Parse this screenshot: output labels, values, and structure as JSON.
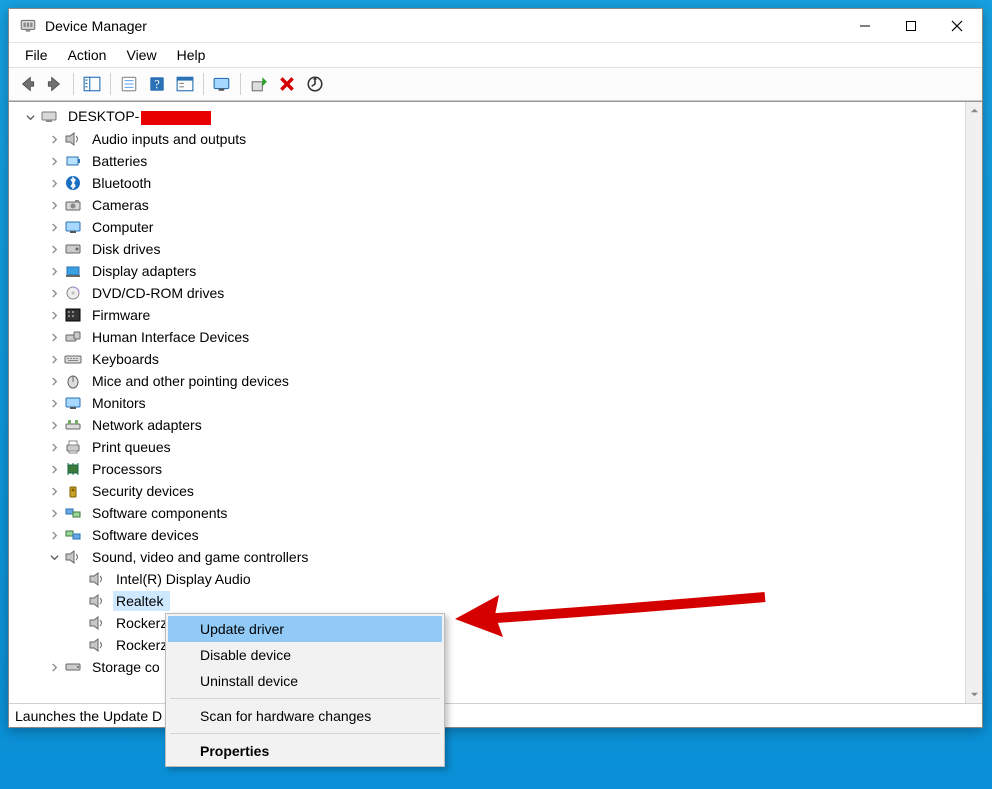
{
  "window": {
    "title": "Device Manager"
  },
  "titlebar_buttons": {
    "minimize": "Minimize",
    "maximize": "Maximize",
    "close": "Close"
  },
  "menubar": [
    "File",
    "Action",
    "View",
    "Help"
  ],
  "toolbar_names": [
    "back",
    "forward",
    "show-hide-console-tree",
    "properties",
    "help",
    "action-view",
    "view-devices",
    "update-driver",
    "uninstall",
    "scan-hardware"
  ],
  "root": {
    "prefix": "DESKTOP-"
  },
  "categories": [
    {
      "k": "audio",
      "label": "Audio inputs and outputs"
    },
    {
      "k": "batteries",
      "label": "Batteries"
    },
    {
      "k": "bluetooth",
      "label": "Bluetooth"
    },
    {
      "k": "cameras",
      "label": "Cameras"
    },
    {
      "k": "computer",
      "label": "Computer"
    },
    {
      "k": "disk",
      "label": "Disk drives"
    },
    {
      "k": "display",
      "label": "Display adapters"
    },
    {
      "k": "dvd",
      "label": "DVD/CD-ROM drives"
    },
    {
      "k": "firmware",
      "label": "Firmware"
    },
    {
      "k": "hid",
      "label": "Human Interface Devices"
    },
    {
      "k": "keyboards",
      "label": "Keyboards"
    },
    {
      "k": "mice",
      "label": "Mice and other pointing devices"
    },
    {
      "k": "monitors",
      "label": "Monitors"
    },
    {
      "k": "network",
      "label": "Network adapters"
    },
    {
      "k": "printq",
      "label": "Print queues"
    },
    {
      "k": "processors",
      "label": "Processors"
    },
    {
      "k": "security",
      "label": "Security devices"
    },
    {
      "k": "swcomp",
      "label": "Software components"
    },
    {
      "k": "swdev",
      "label": "Software devices"
    }
  ],
  "sound_category": {
    "label": "Sound, video and game controllers"
  },
  "sound_children": [
    {
      "label": "Intel(R) Display Audio"
    },
    {
      "label": "Realtek"
    },
    {
      "label": "Rockerz"
    },
    {
      "label": "Rockerz"
    }
  ],
  "last_collapsed": {
    "prefix": "Storage co"
  },
  "context_menu": {
    "items": [
      {
        "label": "Update driver",
        "hover": true
      },
      {
        "label": "Disable device"
      },
      {
        "label": "Uninstall device"
      }
    ],
    "after_sep": [
      {
        "label": "Scan for hardware changes"
      }
    ],
    "bold": [
      {
        "label": "Properties"
      }
    ]
  },
  "statusbar": "Launches the Update D"
}
